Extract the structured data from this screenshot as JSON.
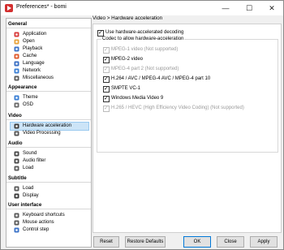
{
  "window": {
    "title": "Preferences* - bomi",
    "minimize_glyph": "—",
    "maximize_glyph": "☐",
    "close_glyph": "✕"
  },
  "sidebar": {
    "categories": [
      {
        "label": "General",
        "items": [
          {
            "label": "Application",
            "icon": "application-icon",
            "color": "#d83b3b"
          },
          {
            "label": "Open",
            "icon": "open-folder-icon",
            "color": "#e8a33c"
          },
          {
            "label": "Playback",
            "icon": "play-icon",
            "color": "#3c73c8"
          },
          {
            "label": "Cache",
            "icon": "cache-icon",
            "color": "#e05a2b"
          },
          {
            "label": "Language",
            "icon": "language-icon",
            "color": "#3a6fc4"
          },
          {
            "label": "Network",
            "icon": "network-icon",
            "color": "#3b7fd4"
          },
          {
            "label": "Miscellaneous",
            "icon": "miscellaneous-icon",
            "color": "#5b5b5b"
          }
        ]
      },
      {
        "label": "Appearance",
        "items": [
          {
            "label": "Theme",
            "icon": "theme-icon",
            "color": "#3b7fd4"
          },
          {
            "label": "OSD",
            "icon": "osd-icon",
            "color": "#6a6a6a"
          }
        ]
      },
      {
        "label": "Video",
        "items": [
          {
            "label": "Hardware acceleration",
            "icon": "hardware-acceleration-icon",
            "color": "#3c3c3c",
            "selected": true
          },
          {
            "label": "Video Processing",
            "icon": "video-processing-icon",
            "color": "#555555"
          }
        ]
      },
      {
        "label": "Audio",
        "items": [
          {
            "label": "Sound",
            "icon": "sound-icon",
            "color": "#4a4a4a"
          },
          {
            "label": "Audio filter",
            "icon": "audio-filter-icon",
            "color": "#4a4a4a"
          },
          {
            "label": "Load",
            "icon": "load-icon",
            "color": "#5b5b5b"
          }
        ]
      },
      {
        "label": "Subtitle",
        "items": [
          {
            "label": "Load",
            "icon": "load-icon",
            "color": "#5b5b5b"
          },
          {
            "label": "Display",
            "icon": "display-icon",
            "color": "#3a3a3a"
          }
        ]
      },
      {
        "label": "User interface",
        "items": [
          {
            "label": "Keyboard shortcuts",
            "icon": "keyboard-icon",
            "color": "#5b5b5b"
          },
          {
            "label": "Mouse actions",
            "icon": "mouse-icon",
            "color": "#5b5b5b"
          },
          {
            "label": "Control step",
            "icon": "control-step-icon",
            "color": "#3c73c8"
          }
        ]
      }
    ]
  },
  "page": {
    "breadcrumb": "Video > Hardware acceleration",
    "use_hw": {
      "label": "Use hardware-accelerated decoding",
      "checked": true
    },
    "group_title": "Codec to allow hardware-acceleration",
    "codecs": [
      {
        "label": "MPEG-1 video (Not supported)",
        "checked": true,
        "enabled": false
      },
      {
        "label": "MPEG-2 video",
        "checked": true,
        "enabled": true
      },
      {
        "label": "MPEG-4 part 2 (Not supported)",
        "checked": true,
        "enabled": false
      },
      {
        "label": "H.264 / AVC / MPEG-4 AVC / MPEG-4 part 10",
        "checked": true,
        "enabled": true
      },
      {
        "label": "SMPTE VC-1",
        "checked": true,
        "enabled": true
      },
      {
        "label": "Windows Media Video 9",
        "checked": true,
        "enabled": true
      },
      {
        "label": "H.265 / HEVC (High Efficiency Video Coding) (Not supported)",
        "checked": true,
        "enabled": false
      }
    ]
  },
  "buttons": {
    "reset": "Reset",
    "restore_defaults": "Restore Defaults",
    "ok": "OK",
    "close": "Close",
    "apply": "Apply"
  },
  "colors": {
    "selection": "#cce4f7",
    "accent": "#0078d7"
  }
}
